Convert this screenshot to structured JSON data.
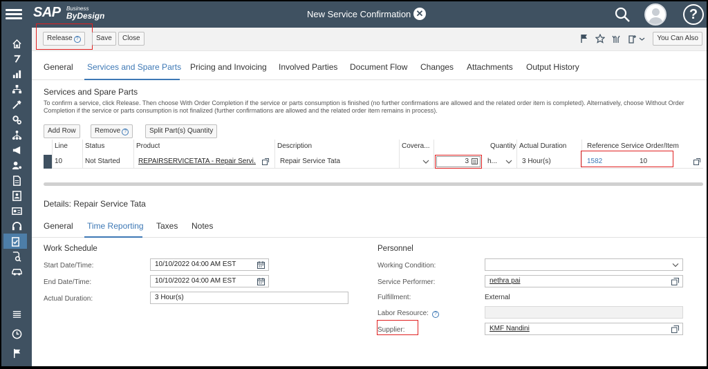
{
  "shell": {
    "logo_sap": "SAP",
    "logo_sub_top": "Business",
    "logo_sub_bottom": "ByDesign",
    "title": "New Service Confirmation",
    "close_glyph": "✕",
    "help_glyph": "?"
  },
  "toolbar": {
    "release_label": "Release",
    "save_label": "Save",
    "close_label": "Close",
    "you_can_also_label": "You Can Also"
  },
  "tabs": [
    {
      "label": "General"
    },
    {
      "label": "Services and Spare Parts"
    },
    {
      "label": "Pricing and Invoicing"
    },
    {
      "label": "Involved Parties"
    },
    {
      "label": "Document Flow"
    },
    {
      "label": "Changes"
    },
    {
      "label": "Attachments"
    },
    {
      "label": "Output History"
    }
  ],
  "services": {
    "title": "Services and Spare Parts",
    "description": "To confirm a service, click Release. Then choose With Order Completion if the service or parts consumption is finished (no further confirmations are allowed and the related order item is completed). Alternatively, choose Without Order Completion if the service or parts consumption is not finalized (further confirmations are allowed and the related order item remains in process).",
    "add_row_label": "Add Row",
    "remove_label": "Remove",
    "split_label": "Split Part(s) Quantity",
    "columns": {
      "line": "Line",
      "status": "Status",
      "product": "Product",
      "description": "Description",
      "coverage": "Covera...",
      "quantity": "Quantity",
      "actual_duration": "Actual Duration",
      "reference": "Reference Service Order/Item"
    },
    "row": {
      "line": "10",
      "status": "Not Started",
      "product": "REPAIRSERVICETATA - Repair Servi...",
      "description": "Repair Service Tata",
      "quantity": "3",
      "unit": "h...",
      "actual_duration": "3 Hour(s)",
      "ref_order": "1582",
      "ref_item": "10"
    }
  },
  "details": {
    "title": "Details: Repair Service Tata",
    "tabs": [
      {
        "label": "General"
      },
      {
        "label": "Time Reporting"
      },
      {
        "label": "Taxes"
      },
      {
        "label": "Notes"
      }
    ],
    "work_schedule": {
      "title": "Work Schedule",
      "start_label": "Start Date/Time:",
      "start_value": "10/10/2022 04:00 AM EST",
      "end_label": "End Date/Time:",
      "end_value": "10/10/2022 04:00 AM EST",
      "actual_duration_label": "Actual Duration:",
      "actual_duration_value": "3 Hour(s)"
    },
    "personnel": {
      "title": "Personnel",
      "working_condition_label": "Working Condition:",
      "working_condition_value": "",
      "service_performer_label": "Service Performer:",
      "service_performer_value": "nethra pai",
      "fulfillment_label": "Fulfillment:",
      "fulfillment_value": "External",
      "labor_resource_label": "Labor Resource:",
      "supplier_label": "Supplier:",
      "supplier_value": "KMF Nandini"
    }
  },
  "colors": {
    "shell_bg": "#3f5161",
    "accent": "#3d78b5",
    "highlight_box": "#e02020"
  }
}
